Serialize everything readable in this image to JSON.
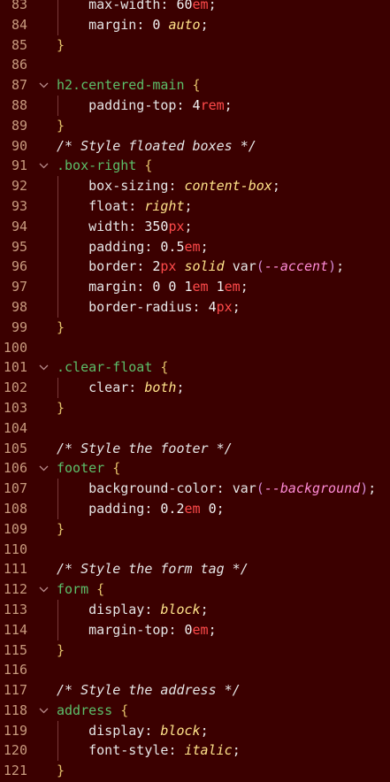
{
  "editor": {
    "lines": [
      {
        "n": "83",
        "fold": false,
        "guide": true,
        "tokens": [
          [
            "prop",
            "    max-width"
          ],
          [
            "punc",
            ": "
          ],
          [
            "num-v",
            "60"
          ],
          [
            "unit",
            "em"
          ],
          [
            "punc",
            ";"
          ]
        ]
      },
      {
        "n": "84",
        "fold": false,
        "guide": true,
        "tokens": [
          [
            "prop",
            "    margin"
          ],
          [
            "punc",
            ": "
          ],
          [
            "num-v",
            "0 "
          ],
          [
            "kw",
            "auto"
          ],
          [
            "punc",
            ";"
          ]
        ]
      },
      {
        "n": "85",
        "fold": false,
        "guide": false,
        "tokens": [
          [
            "brace",
            "}"
          ]
        ]
      },
      {
        "n": "86",
        "fold": false,
        "guide": false,
        "tokens": []
      },
      {
        "n": "87",
        "fold": true,
        "guide": false,
        "tokens": [
          [
            "sel",
            "h2.centered-main "
          ],
          [
            "brace",
            "{"
          ]
        ]
      },
      {
        "n": "88",
        "fold": false,
        "guide": true,
        "tokens": [
          [
            "prop",
            "    padding-top"
          ],
          [
            "punc",
            ": "
          ],
          [
            "num-v",
            "4"
          ],
          [
            "unit",
            "rem"
          ],
          [
            "punc",
            ";"
          ]
        ]
      },
      {
        "n": "89",
        "fold": false,
        "guide": false,
        "tokens": [
          [
            "brace",
            "}"
          ]
        ]
      },
      {
        "n": "90",
        "fold": false,
        "guide": false,
        "tokens": [
          [
            "comment",
            "/* Style floated boxes */"
          ]
        ]
      },
      {
        "n": "91",
        "fold": true,
        "guide": false,
        "tokens": [
          [
            "sel",
            ".box-right "
          ],
          [
            "brace",
            "{"
          ]
        ]
      },
      {
        "n": "92",
        "fold": false,
        "guide": true,
        "tokens": [
          [
            "prop",
            "    box-sizing"
          ],
          [
            "punc",
            ": "
          ],
          [
            "kw",
            "content-box"
          ],
          [
            "punc",
            ";"
          ]
        ]
      },
      {
        "n": "93",
        "fold": false,
        "guide": true,
        "tokens": [
          [
            "prop",
            "    float"
          ],
          [
            "punc",
            ": "
          ],
          [
            "kw",
            "right"
          ],
          [
            "punc",
            ";"
          ]
        ]
      },
      {
        "n": "94",
        "fold": false,
        "guide": true,
        "tokens": [
          [
            "prop",
            "    width"
          ],
          [
            "punc",
            ": "
          ],
          [
            "num-v",
            "350"
          ],
          [
            "unit",
            "px"
          ],
          [
            "punc",
            ";"
          ]
        ]
      },
      {
        "n": "95",
        "fold": false,
        "guide": true,
        "tokens": [
          [
            "prop",
            "    padding"
          ],
          [
            "punc",
            ": "
          ],
          [
            "num-v",
            "0.5"
          ],
          [
            "unit",
            "em"
          ],
          [
            "punc",
            ";"
          ]
        ]
      },
      {
        "n": "96",
        "fold": false,
        "guide": true,
        "tokens": [
          [
            "prop",
            "    border"
          ],
          [
            "punc",
            ": "
          ],
          [
            "num-v",
            "2"
          ],
          [
            "unit",
            "px "
          ],
          [
            "kw",
            "solid "
          ],
          [
            "fn",
            "var"
          ],
          [
            "paren",
            "("
          ],
          [
            "var",
            "--accent"
          ],
          [
            "paren",
            ")"
          ],
          [
            "punc",
            ";"
          ]
        ]
      },
      {
        "n": "97",
        "fold": false,
        "guide": true,
        "tokens": [
          [
            "prop",
            "    margin"
          ],
          [
            "punc",
            ": "
          ],
          [
            "num-v",
            "0 0 1"
          ],
          [
            "unit",
            "em "
          ],
          [
            "num-v",
            "1"
          ],
          [
            "unit",
            "em"
          ],
          [
            "punc",
            ";"
          ]
        ]
      },
      {
        "n": "98",
        "fold": false,
        "guide": true,
        "tokens": [
          [
            "prop",
            "    border-radius"
          ],
          [
            "punc",
            ": "
          ],
          [
            "num-v",
            "4"
          ],
          [
            "unit",
            "px"
          ],
          [
            "punc",
            ";"
          ]
        ]
      },
      {
        "n": "99",
        "fold": false,
        "guide": false,
        "tokens": [
          [
            "brace",
            "}"
          ]
        ]
      },
      {
        "n": "100",
        "fold": false,
        "guide": false,
        "tokens": []
      },
      {
        "n": "101",
        "fold": true,
        "guide": false,
        "tokens": [
          [
            "sel",
            ".clear-float "
          ],
          [
            "brace",
            "{"
          ]
        ]
      },
      {
        "n": "102",
        "fold": false,
        "guide": true,
        "tokens": [
          [
            "prop",
            "    clear"
          ],
          [
            "punc",
            ": "
          ],
          [
            "kw",
            "both"
          ],
          [
            "punc",
            ";"
          ]
        ]
      },
      {
        "n": "103",
        "fold": false,
        "guide": false,
        "tokens": [
          [
            "brace",
            "}"
          ]
        ]
      },
      {
        "n": "104",
        "fold": false,
        "guide": false,
        "tokens": []
      },
      {
        "n": "105",
        "fold": false,
        "guide": false,
        "tokens": [
          [
            "comment",
            "/* Style the footer */"
          ]
        ]
      },
      {
        "n": "106",
        "fold": true,
        "guide": false,
        "tokens": [
          [
            "sel",
            "footer "
          ],
          [
            "brace",
            "{"
          ]
        ]
      },
      {
        "n": "107",
        "fold": false,
        "guide": true,
        "tokens": [
          [
            "prop",
            "    background-color"
          ],
          [
            "punc",
            ": "
          ],
          [
            "fn",
            "var"
          ],
          [
            "paren",
            "("
          ],
          [
            "var",
            "--background"
          ],
          [
            "paren",
            ")"
          ],
          [
            "punc",
            ";"
          ]
        ]
      },
      {
        "n": "108",
        "fold": false,
        "guide": true,
        "tokens": [
          [
            "prop",
            "    padding"
          ],
          [
            "punc",
            ": "
          ],
          [
            "num-v",
            "0.2"
          ],
          [
            "unit",
            "em "
          ],
          [
            "num-v",
            "0"
          ],
          [
            "punc",
            ";"
          ]
        ]
      },
      {
        "n": "109",
        "fold": false,
        "guide": false,
        "tokens": [
          [
            "brace",
            "}"
          ]
        ]
      },
      {
        "n": "110",
        "fold": false,
        "guide": false,
        "tokens": []
      },
      {
        "n": "111",
        "fold": false,
        "guide": false,
        "tokens": [
          [
            "comment",
            "/* Style the form tag */"
          ]
        ]
      },
      {
        "n": "112",
        "fold": true,
        "guide": false,
        "tokens": [
          [
            "sel",
            "form "
          ],
          [
            "brace",
            "{"
          ]
        ]
      },
      {
        "n": "113",
        "fold": false,
        "guide": true,
        "tokens": [
          [
            "prop",
            "    display"
          ],
          [
            "punc",
            ": "
          ],
          [
            "kw",
            "block"
          ],
          [
            "punc",
            ";"
          ]
        ]
      },
      {
        "n": "114",
        "fold": false,
        "guide": true,
        "tokens": [
          [
            "prop",
            "    margin-top"
          ],
          [
            "punc",
            ": "
          ],
          [
            "num-v",
            "0"
          ],
          [
            "unit",
            "em"
          ],
          [
            "punc",
            ";"
          ]
        ]
      },
      {
        "n": "115",
        "fold": false,
        "guide": false,
        "tokens": [
          [
            "brace",
            "}"
          ]
        ]
      },
      {
        "n": "116",
        "fold": false,
        "guide": false,
        "tokens": []
      },
      {
        "n": "117",
        "fold": false,
        "guide": false,
        "tokens": [
          [
            "comment",
            "/* Style the address */"
          ]
        ]
      },
      {
        "n": "118",
        "fold": true,
        "guide": false,
        "tokens": [
          [
            "sel",
            "address "
          ],
          [
            "brace",
            "{"
          ]
        ]
      },
      {
        "n": "119",
        "fold": false,
        "guide": true,
        "tokens": [
          [
            "prop",
            "    display"
          ],
          [
            "punc",
            ": "
          ],
          [
            "kw",
            "block"
          ],
          [
            "punc",
            ";"
          ]
        ]
      },
      {
        "n": "120",
        "fold": false,
        "guide": true,
        "tokens": [
          [
            "prop",
            "    font-style"
          ],
          [
            "punc",
            ": "
          ],
          [
            "kw",
            "italic"
          ],
          [
            "punc",
            ";"
          ]
        ]
      },
      {
        "n": "121",
        "fold": false,
        "guide": false,
        "tokens": [
          [
            "brace",
            "}"
          ]
        ]
      }
    ]
  }
}
